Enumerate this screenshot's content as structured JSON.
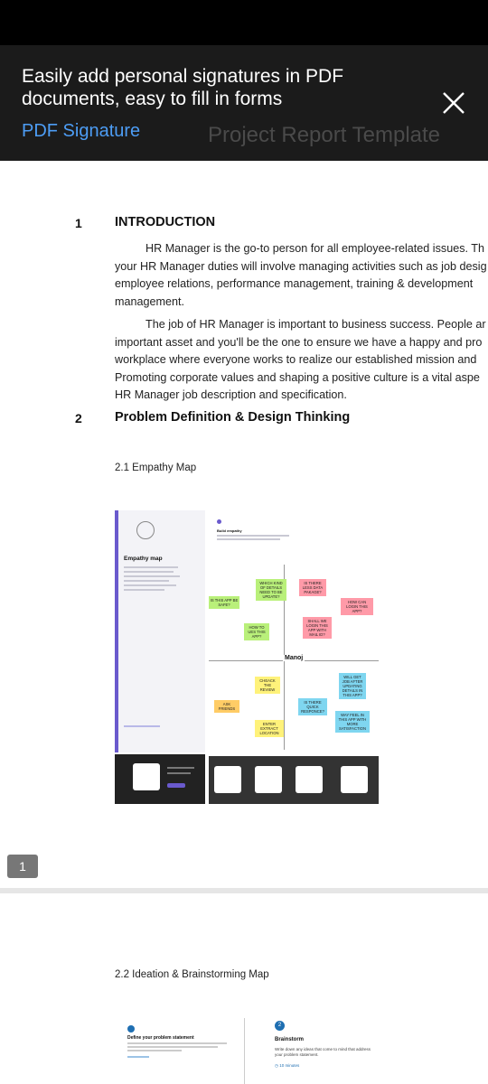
{
  "banner": {
    "headline": "Easily add personal signatures in PDF documents, easy to fill in forms",
    "link": "PDF Signature",
    "ghost_title": "Project Report Template"
  },
  "document": {
    "sections": [
      {
        "num": "1",
        "title": "INTRODUCTION"
      },
      {
        "num": "2",
        "title": "Problem Definition & Design Thinking"
      }
    ],
    "para1": [
      "HR Manager is the go-to person for all employee-related issues. Th",
      "your HR Manager duties will involve managing activities such as job desig",
      "employee relations, performance management, training & development",
      "management."
    ],
    "para2": [
      "The job of HR Manager is important to business success. People ar",
      "important asset and you'll be the one to ensure we have a happy and pro",
      "workplace where everyone works to realize our established mission and",
      "Promoting corporate values and shaping a positive culture is a vital aspe",
      "HR Manager job description and specification."
    ],
    "sub1": "2.1 Empathy Map",
    "sub2": "2.2 Ideation & Brainstorming Map"
  },
  "empathy_map": {
    "panel_title": "Empathy map",
    "build_label": "Build empathy",
    "persona": "Manoj",
    "notes": [
      "WHICH KIND OF DETAILS NEED TO BE UPDATE?",
      "IS THERE LESS DATA PAKAGE?",
      "IS THIS APP BE SAFE?",
      "HOW CAN LOGIN THIS APP?",
      "SHALL WE LOGIN THIS APP WITH MAIL ID?",
      "HOW TO UES THIS APP?",
      "WILL GET JOB AFTER UPDATING DETAILS IN THIS APP?",
      "CHEACK THE REVIEW",
      "IS THERE QUICK RESPONCE?",
      "ASK FRIENDS",
      "ENTER EXTRACT LOCATION",
      "WAY FEEL IN THIS APP WITH MORE SATISFACTION"
    ]
  },
  "page_indicator": "1",
  "brainstorm": {
    "step1_title": "Define your problem statement",
    "step2_num": "2",
    "step2_title": "Brainstorm",
    "step2_desc": "Write down any ideas that come to mind that address your problem statement.",
    "step2_time": "10 minutes"
  },
  "colors": {
    "banner_bg": "#1b1b1b",
    "link": "#4d9df5",
    "accent": "#6a5acd"
  }
}
